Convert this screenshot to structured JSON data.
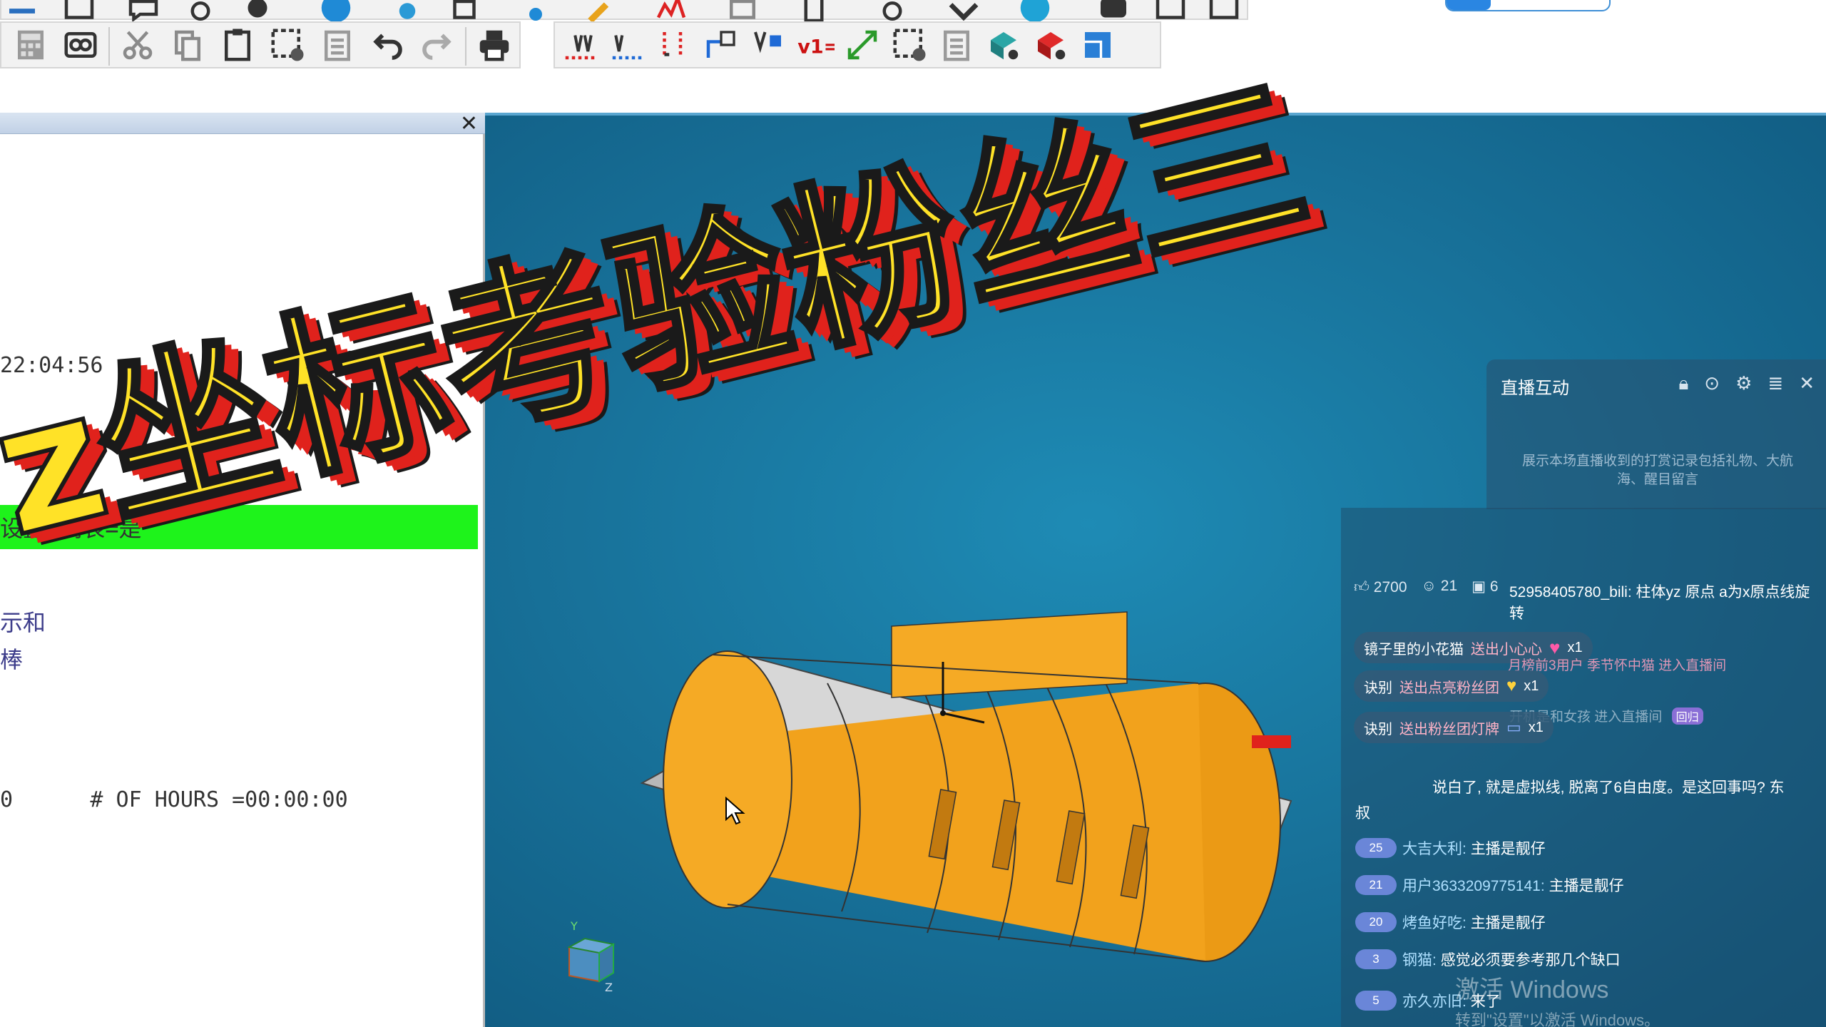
{
  "left_panel": {
    "close_glyph": "✕",
    "time_text": "22:04:56",
    "green_row_text": "设置,列表=是",
    "fragment_1": "示和",
    "fragment_2": "棒",
    "hours_text": "0      # OF HOURS =00:00:00"
  },
  "viewport": {
    "axis_label_y": "Y",
    "axis_label_z": "Z"
  },
  "live_panel": {
    "title": "直播互动",
    "description": "展示本场直播收到的打赏记录包括礼物、大航海、醒目留言",
    "icons": [
      "lock-icon",
      "mic-icon",
      "settings-icon",
      "collapse-icon",
      "close-icon"
    ]
  },
  "chat": {
    "stats": {
      "likes": "2700",
      "viewers": "21",
      "rank": "6"
    },
    "top_message": "52958405780_bili: 柱体yz 原点 a为x原点线旋转",
    "gifts": [
      {
        "user": "镜子里的小花猫",
        "action": "送出小心心",
        "count": "x1"
      },
      {
        "user": "诀别",
        "action": "送出点亮粉丝团",
        "count": "x1"
      },
      {
        "user": "诀别",
        "action": "送出粉丝团灯牌",
        "count": "x1"
      }
    ],
    "faded_1": "月榜前3用户 季节怀中猫 进入直播间",
    "faded_2": "开机是和女孩 进入直播间",
    "faded_badge": "回归",
    "long_msg_1": "说白了, 就是虚拟线, 脱离了6自由度。是这回事吗? 东",
    "long_msg_2": "叔",
    "messages": [
      {
        "level": "25",
        "user": "大吉大利:",
        "text": "主播是靓仔"
      },
      {
        "level": "21",
        "user": "用户3633209775141:",
        "text": "主播是靓仔"
      },
      {
        "level": "20",
        "user": "烤鱼好吃:",
        "text": "主播是靓仔"
      },
      {
        "level": "3",
        "user": "钢猫:",
        "text": "感觉必须要参考那几个缺口"
      },
      {
        "level": "5",
        "user": "亦久亦旧:",
        "text": "来了"
      }
    ]
  },
  "watermark": {
    "title": "激活 Windows",
    "subtitle": "转到\"设置\"以激活 Windows。"
  },
  "overlay_title": "z坐标考验粉丝三",
  "colors": {
    "viewport_bg": "#176f97",
    "part_orange": "#f2a21c",
    "part_gray": "#d9d9d9",
    "green_highlight": "#1ef31b",
    "title_yellow": "#ffe227",
    "title_shadow_red": "#e0221c"
  }
}
